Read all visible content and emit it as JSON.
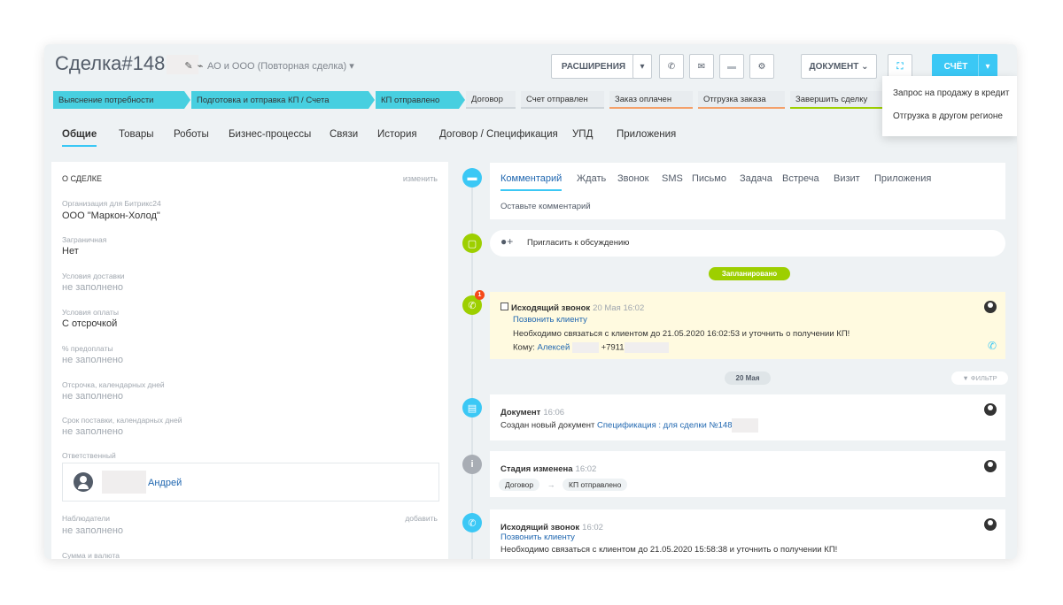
{
  "header": {
    "title": "Сделка#148",
    "subtitle": "АО и ООО (Повторная сделка)",
    "btn_ext": "РАСШИРЕНИЯ",
    "btn_doc": "ДОКУМЕНТ",
    "btn_bill": "СЧЁТ"
  },
  "stages": [
    {
      "label": "Выяснение потребности",
      "state": "active"
    },
    {
      "label": "Подготовка и отправка КП / Счета",
      "state": "active"
    },
    {
      "label": "КП отправлено",
      "state": "active"
    },
    {
      "label": "Договор",
      "state": "inactive",
      "color": "#cfd5da"
    },
    {
      "label": "Счет отправлен",
      "state": "inactive",
      "color": "#cfd5da"
    },
    {
      "label": "Заказ оплачен",
      "state": "inactive",
      "color": "#f4a06a"
    },
    {
      "label": "Отгрузка заказа",
      "state": "inactive",
      "color": "#f4a06a"
    },
    {
      "label": "Завершить сделку",
      "state": "inactive",
      "color": "#9dcf00"
    }
  ],
  "dropdown": {
    "items": [
      "Запрос на продажу в кредит",
      "Отгрузка в другом регионе"
    ]
  },
  "tabs": [
    "Общие",
    "Товары",
    "Роботы",
    "Бизнес-процессы",
    "Связи",
    "История",
    "Договор / Спецификация",
    "УПД",
    "Приложения"
  ],
  "left": {
    "section_title": "О СДЕЛКЕ",
    "edit_label": "изменить",
    "fields": [
      {
        "label": "Организация для Битрикс24",
        "value": "ООО \"Маркон-Холод\"",
        "empty": false
      },
      {
        "label": "Заграничная",
        "value": "Нет",
        "empty": false
      },
      {
        "label": "Условия доставки",
        "value": "не заполнено",
        "empty": true
      },
      {
        "label": "Условия оплаты",
        "value": "С отсрочкой",
        "empty": false
      },
      {
        "label": "% предоплаты",
        "value": "не заполнено",
        "empty": true
      },
      {
        "label": "Отсрочка, календарных дней",
        "value": "не заполнено",
        "empty": true
      },
      {
        "label": "Срок поставки, календарных дней",
        "value": "не заполнено",
        "empty": true
      }
    ],
    "responsible_label": "Ответственный",
    "responsible_name": "Андрей",
    "observers_label": "Наблюдатели",
    "observers_add": "добавить",
    "observers_value": "не заполнено",
    "cut_label": "Сумма и валюта"
  },
  "timeline": {
    "tabs": [
      "Комментарий",
      "Ждать",
      "Звонок",
      "SMS",
      "Письмо",
      "Задача",
      "Встреча",
      "Визит",
      "Приложения"
    ],
    "comment_placeholder": "Оставьте комментарий",
    "invite": "Пригласить к обсуждению",
    "planned_badge": "Запланировано",
    "call1": {
      "title": "Исходящий звонок",
      "time": "20 Мая 16:02",
      "link": "Позвонить клиенту",
      "text": "Необходимо связаться с клиентом до 21.05.2020 16:02:53 и уточнить о получении КП!",
      "to_label": "Кому:",
      "to_name": "Алексей",
      "phone": "+7911"
    },
    "date_badge": "20 Мая",
    "filter": "ФИЛЬТР",
    "doc": {
      "title": "Документ",
      "time": "16:06",
      "text": "Создан новый документ",
      "link": "Спецификация : для сделки №148"
    },
    "stage": {
      "title": "Стадия изменена",
      "time": "16:02",
      "from": "Договор",
      "to": "КП отправлено"
    },
    "call2": {
      "title": "Исходящий звонок",
      "time": "16:02",
      "link": "Позвонить клиенту",
      "text": "Необходимо связаться с клиентом до 21.05.2020 15:58:38 и уточнить о получении КП!"
    },
    "counter": "1"
  }
}
